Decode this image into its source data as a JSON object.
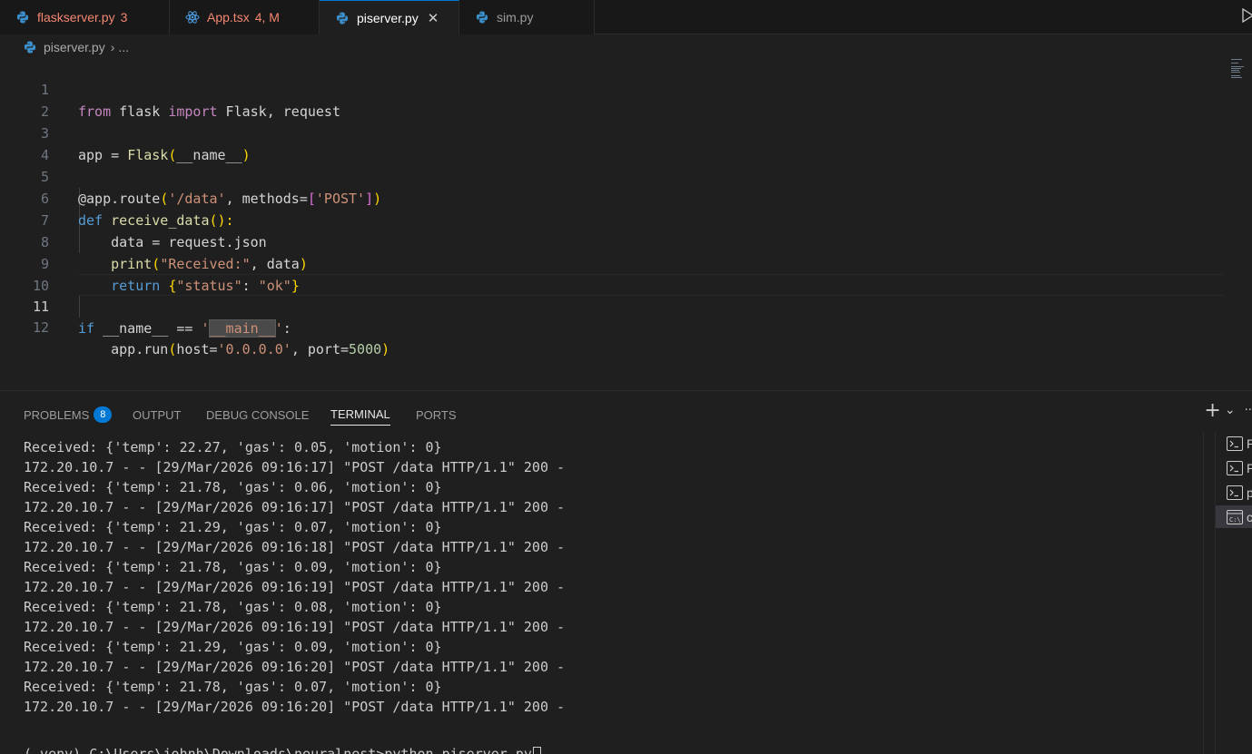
{
  "tabs": [
    {
      "label": "flaskserver.py",
      "badge": "3",
      "icon": "python-icon",
      "state": "error"
    },
    {
      "label": "App.tsx",
      "badge": "4, M",
      "icon": "react-icon",
      "state": "error"
    },
    {
      "label": "piserver.py",
      "badge": "",
      "icon": "python-icon",
      "state": "active",
      "close": "✕"
    },
    {
      "label": "sim.py",
      "badge": "",
      "icon": "python-icon",
      "state": "plain"
    }
  ],
  "breadcrumb": {
    "file": "piserver.py",
    "separator": "›",
    "more": "..."
  },
  "editor": {
    "current_line": 11,
    "line_numbers": [
      "1",
      "2",
      "3",
      "4",
      "5",
      "6",
      "7",
      "8",
      "9",
      "10",
      "11",
      "12"
    ]
  },
  "code": {
    "l1": {
      "from": "from",
      "mod": " flask ",
      "imp": "import",
      "rest": " Flask, request"
    },
    "l3": {
      "a": "app = ",
      "fn": "Flask",
      "p1": "(",
      "arg": "__name__",
      "p2": ")"
    },
    "l5": {
      "deco": "@app.route",
      "p1": "(",
      "s1": "'/data'",
      "mid": ", methods=",
      "b1": "[",
      "s2": "'POST'",
      "b2": "]",
      "p2": ")"
    },
    "l6": {
      "kw": "def",
      "fn": " receive_data",
      "p": "():"
    },
    "l7": {
      "a": "    data = request.json"
    },
    "l8": {
      "fn": "    print",
      "p1": "(",
      "s": "\"Received:\"",
      "mid": ", data",
      "p2": ")"
    },
    "l9": {
      "kw": "    return",
      "sp": " ",
      "b1": "{",
      "s1": "\"status\"",
      "c": ": ",
      "s2": "\"ok\"",
      "b2": "}"
    },
    "l11": {
      "kw": "if",
      "a": " __name__ == ",
      "q1": "'",
      "sel": "__main__",
      "q2": "'",
      "c": ":"
    },
    "l12": {
      "a": "    app.run",
      "p1": "(",
      "h": "host=",
      "s": "'0.0.0.0'",
      "m": ", port=",
      "n": "5000",
      "p2": ")"
    }
  },
  "panel": {
    "tabs": [
      "PROBLEMS",
      "OUTPUT",
      "DEBUG CONSOLE",
      "TERMINAL",
      "PORTS"
    ],
    "problems_count": "8",
    "active_tab": "TERMINAL",
    "actions": {
      "add": "+",
      "dropdown": "⌄",
      "more": "···"
    }
  },
  "terminal": {
    "lines": [
      "Received: {'temp': 22.27, 'gas': 0.05, 'motion': 0}",
      "172.20.10.7 - - [29/Mar/2026 09:16:17] \"POST /data HTTP/1.1\" 200 -",
      "Received: {'temp': 21.78, 'gas': 0.06, 'motion': 0}",
      "172.20.10.7 - - [29/Mar/2026 09:16:17] \"POST /data HTTP/1.1\" 200 -",
      "Received: {'temp': 21.29, 'gas': 0.07, 'motion': 0}",
      "172.20.10.7 - - [29/Mar/2026 09:16:18] \"POST /data HTTP/1.1\" 200 -",
      "Received: {'temp': 21.78, 'gas': 0.09, 'motion': 0}",
      "172.20.10.7 - - [29/Mar/2026 09:16:19] \"POST /data HTTP/1.1\" 200 -",
      "Received: {'temp': 21.78, 'gas': 0.08, 'motion': 0}",
      "172.20.10.7 - - [29/Mar/2026 09:16:19] \"POST /data HTTP/1.1\" 200 -",
      "Received: {'temp': 21.29, 'gas': 0.09, 'motion': 0}",
      "172.20.10.7 - - [29/Mar/2026 09:16:20] \"POST /data HTTP/1.1\" 200 -",
      "Received: {'temp': 21.78, 'gas': 0.07, 'motion': 0}",
      "172.20.10.7 - - [29/Mar/2026 09:16:20] \"POST /data HTTP/1.1\" 200 -",
      "",
      "(.venv) C:\\Users\\johnh\\Downloads\\neuralnest>python piserver.py"
    ]
  },
  "terminal_list": [
    {
      "label": "P",
      "icon": "terminal-icon"
    },
    {
      "label": "P",
      "icon": "terminal-icon"
    },
    {
      "label": "p",
      "icon": "terminal-icon"
    },
    {
      "label": "c",
      "icon": "cmd-icon",
      "selected": true
    }
  ],
  "colors": {
    "accent": "#0078d4",
    "error_tab": "#f48771",
    "keyword": "#569cd6",
    "string": "#ce9178"
  }
}
